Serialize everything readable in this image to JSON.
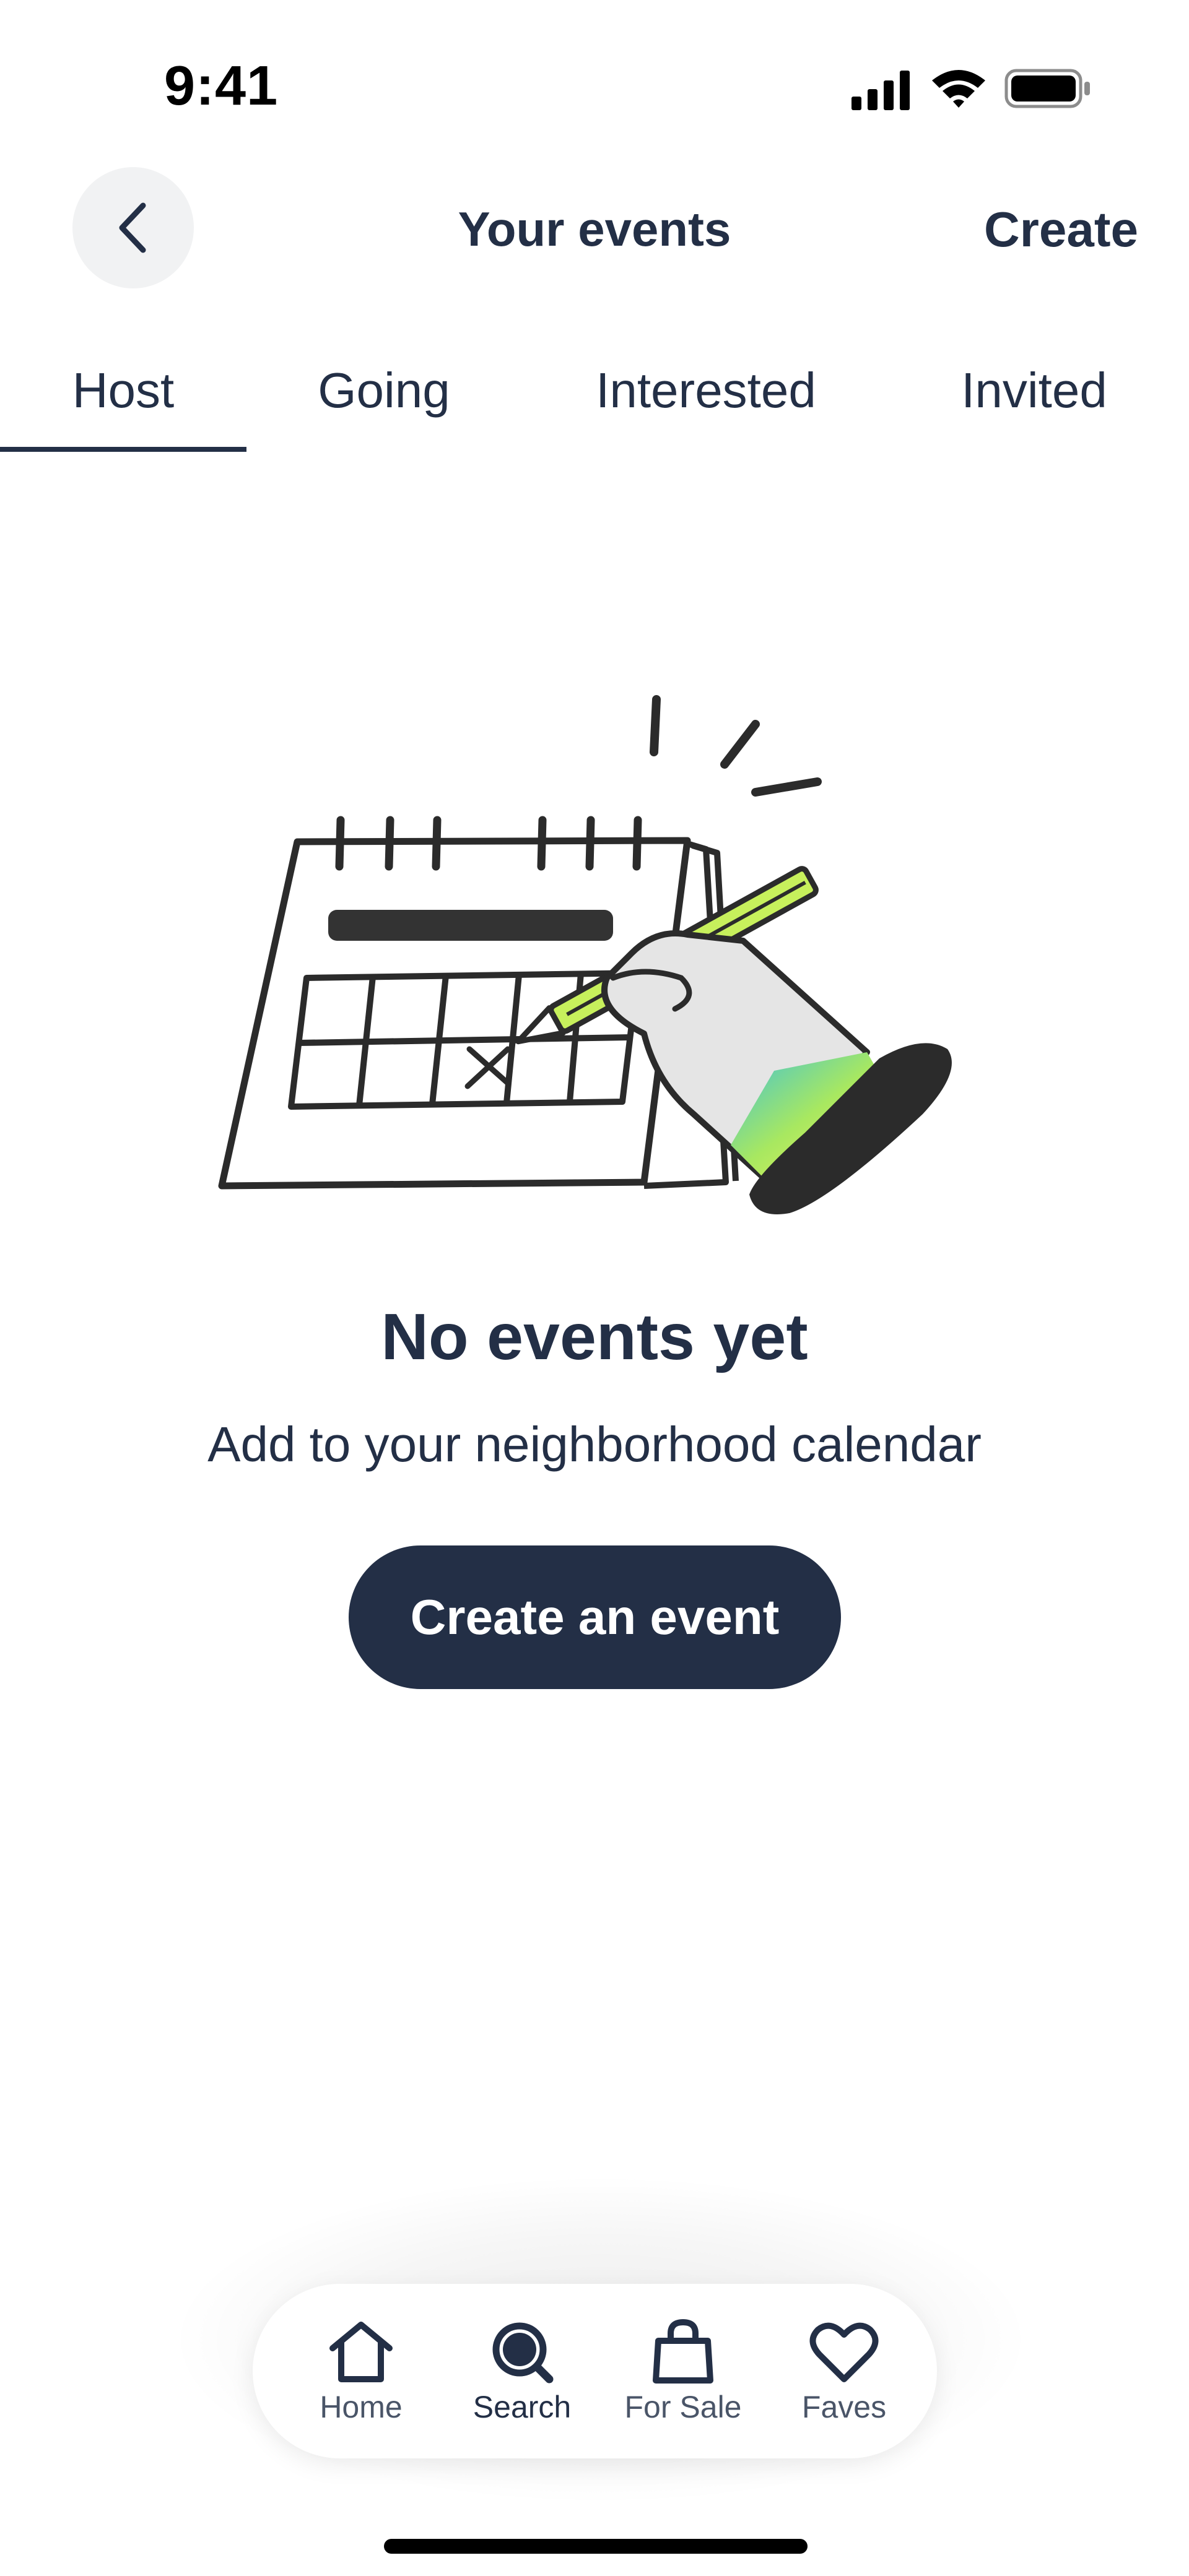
{
  "status_bar": {
    "time": "9:41"
  },
  "header": {
    "title": "Your events",
    "create_label": "Create"
  },
  "tabs": [
    {
      "label": "Host",
      "active": true
    },
    {
      "label": "Going",
      "active": false
    },
    {
      "label": "Interested",
      "active": false
    },
    {
      "label": "Invited",
      "active": false
    }
  ],
  "empty_state": {
    "title": "No events yet",
    "subtitle": "Add to your neighborhood calendar",
    "cta_label": "Create an event"
  },
  "bottom_nav": {
    "items": [
      {
        "label": "Home",
        "icon": "home-icon",
        "active": false
      },
      {
        "label": "Search",
        "icon": "search-icon",
        "active": true
      },
      {
        "label": "For Sale",
        "icon": "shopping-bag-icon",
        "active": false
      },
      {
        "label": "Faves",
        "icon": "heart-icon",
        "active": false
      }
    ]
  },
  "colors": {
    "primary": "#232f46",
    "background": "#ffffff",
    "back_button_bg": "#f1f2f3",
    "pencil_accent": "#c7f05c"
  }
}
